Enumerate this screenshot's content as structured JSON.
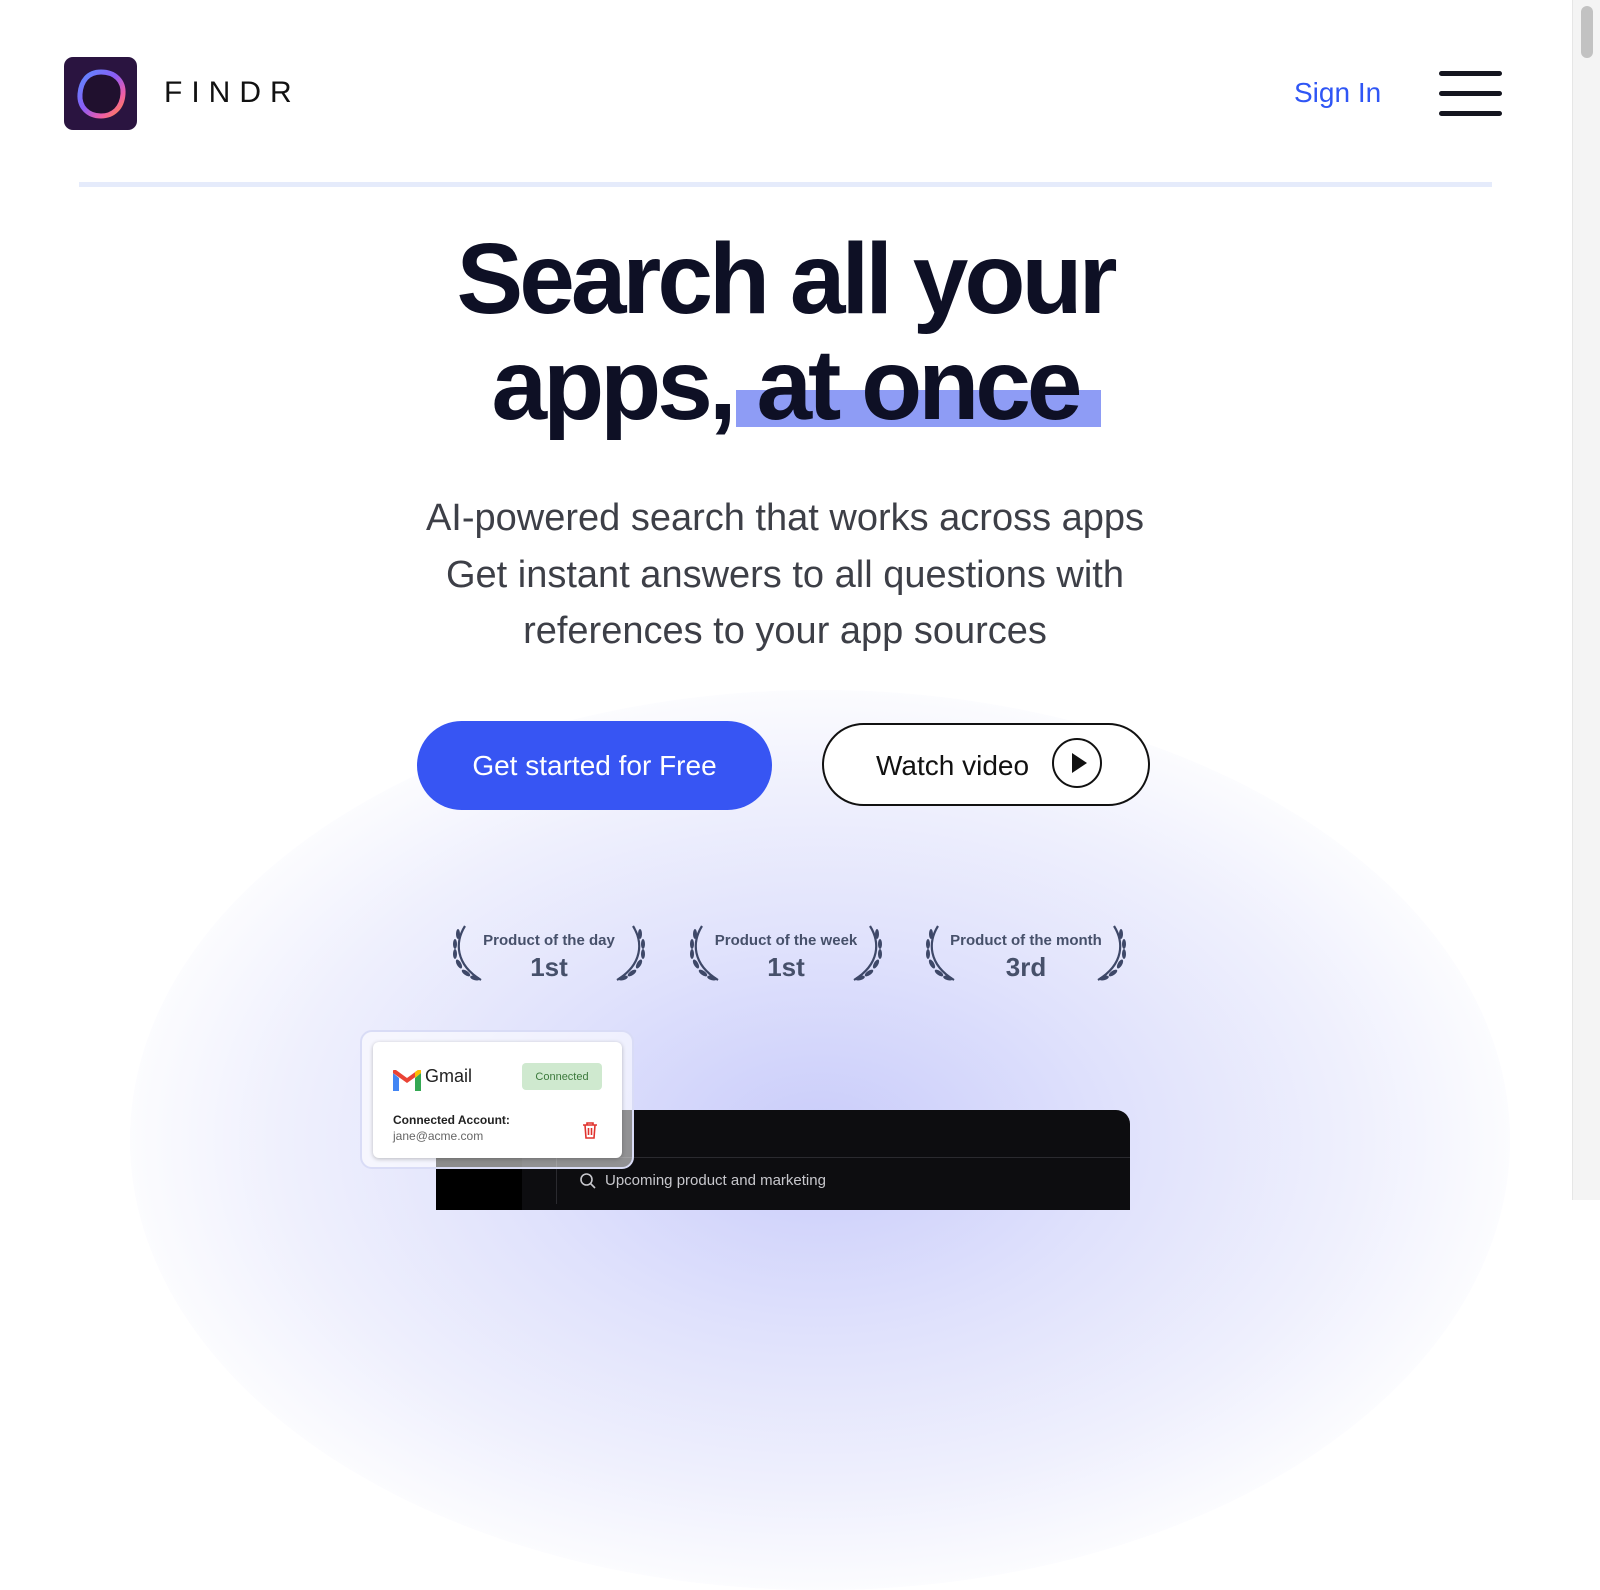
{
  "header": {
    "brand": "FINDR",
    "sign_in": "Sign In"
  },
  "hero": {
    "title_line1": "Search all your",
    "title_line2_plain": "apps,",
    "title_line2_highlight": "at once",
    "subtitle": [
      "AI-powered search that works across apps",
      "Get instant answers to all questions with",
      "references to your app sources"
    ],
    "primary_button": "Get started for Free",
    "secondary_button": "Watch video"
  },
  "awards": [
    {
      "label": "Product of the day",
      "rank": "1st"
    },
    {
      "label": "Product of the week",
      "rank": "1st"
    },
    {
      "label": "Product of the month",
      "rank": "3rd"
    }
  ],
  "integration_card": {
    "app_name": "Gmail",
    "status": "Connected",
    "account_label": "Connected Account:",
    "account_email": "jane@acme.com"
  },
  "app_preview": {
    "search_query": "Upcoming product and marketing"
  },
  "colors": {
    "accent": "#3755f3",
    "link": "#2f56f5",
    "highlight": "#8e9cf5",
    "text_dark": "#0e1025"
  },
  "icons": [
    "findr-logo-icon",
    "menu-icon",
    "play-icon",
    "laurel-icon",
    "gmail-icon",
    "trash-icon",
    "search-icon"
  ]
}
